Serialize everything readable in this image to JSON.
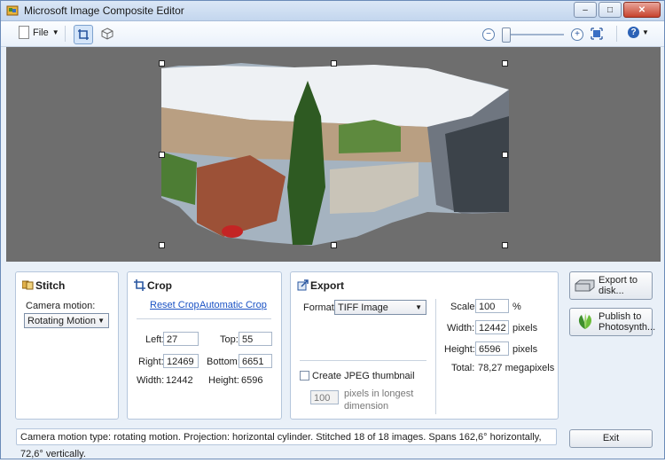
{
  "window": {
    "title": "Microsoft Image Composite Editor"
  },
  "toolbar": {
    "file_label": "File"
  },
  "stitch": {
    "title": "Stitch",
    "camera_motion_label": "Camera motion:",
    "camera_motion_value": "Rotating Motion"
  },
  "crop": {
    "title": "Crop",
    "reset_crop": "Reset Crop",
    "automatic_crop": "Automatic Crop",
    "left_label": "Left:",
    "left_value": "27",
    "top_label": "Top:",
    "top_value": "55",
    "right_label": "Right:",
    "right_value": "12469",
    "bottom_label": "Bottom:",
    "bottom_value": "6651",
    "width_label": "Width:",
    "width_value": "12442",
    "height_label": "Height:",
    "height_value": "6596"
  },
  "export": {
    "title": "Export",
    "format_label": "Format:",
    "format_value": "TIFF Image",
    "jpeg_thumb_label": "Create JPEG thumbnail",
    "thumb_pixels_value": "100",
    "thumb_pixels_label_1": "pixels in longest",
    "thumb_pixels_label_2": "dimension",
    "scale_label": "Scale:",
    "scale_value": "100",
    "scale_unit": "%",
    "width_label": "Width:",
    "width_value": "12442",
    "width_unit": "pixels",
    "height_label": "Height:",
    "height_value": "6596",
    "height_unit": "pixels",
    "total_label": "Total:",
    "total_value": "78,27 megapixels"
  },
  "actions": {
    "export_disk_1": "Export to",
    "export_disk_2": "disk...",
    "publish_1": "Publish to",
    "publish_2": "Photosynth...",
    "exit": "Exit"
  },
  "status": {
    "text": "Camera motion type: rotating motion. Projection: horizontal cylinder. Stitched 18 of 18 images. Spans 162,6° horizontally, 72,6° vertically."
  },
  "colors": {
    "canvas_bg": "#6e6e6e",
    "link": "#1a52c4",
    "accent": "#2c62b6"
  }
}
